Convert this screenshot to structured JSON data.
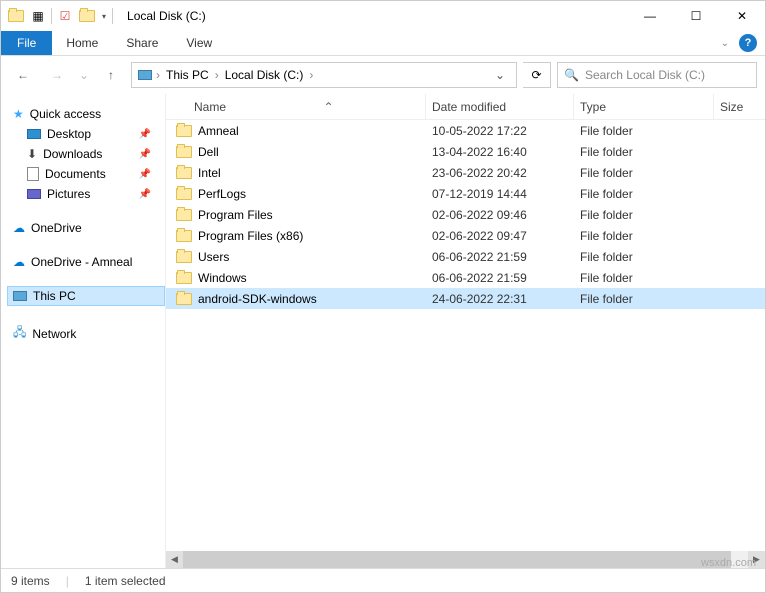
{
  "title": "Local Disk (C:)",
  "ribbon": {
    "file": "File",
    "tabs": [
      "Home",
      "Share",
      "View"
    ]
  },
  "breadcrumb": [
    "This PC",
    "Local Disk (C:)"
  ],
  "search_placeholder": "Search Local Disk (C:)",
  "columns": {
    "name": "Name",
    "date": "Date modified",
    "type": "Type",
    "size": "Size"
  },
  "sidebar": {
    "quick_access": "Quick access",
    "pinned": [
      "Desktop",
      "Downloads",
      "Documents",
      "Pictures"
    ],
    "onedrive": "OneDrive",
    "onedrive_amneal": "OneDrive - Amneal",
    "this_pc": "This PC",
    "network": "Network"
  },
  "rows": [
    {
      "name": "Amneal",
      "date": "10-05-2022 17:22",
      "type": "File folder"
    },
    {
      "name": "Dell",
      "date": "13-04-2022 16:40",
      "type": "File folder"
    },
    {
      "name": "Intel",
      "date": "23-06-2022 20:42",
      "type": "File folder"
    },
    {
      "name": "PerfLogs",
      "date": "07-12-2019 14:44",
      "type": "File folder"
    },
    {
      "name": "Program Files",
      "date": "02-06-2022 09:46",
      "type": "File folder"
    },
    {
      "name": "Program Files (x86)",
      "date": "02-06-2022 09:47",
      "type": "File folder"
    },
    {
      "name": "Users",
      "date": "06-06-2022 21:59",
      "type": "File folder"
    },
    {
      "name": "Windows",
      "date": "06-06-2022 21:59",
      "type": "File folder"
    },
    {
      "name": "android-SDK-windows",
      "date": "24-06-2022 22:31",
      "type": "File folder",
      "selected": true
    }
  ],
  "status": {
    "count": "9 items",
    "selected": "1 item selected"
  },
  "watermark": "wsxdn.com"
}
